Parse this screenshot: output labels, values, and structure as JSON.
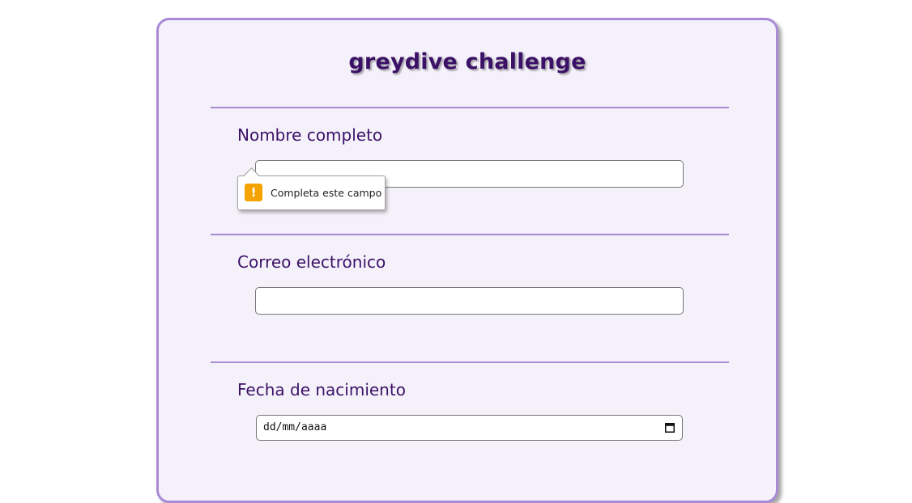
{
  "form": {
    "title": "greydive challenge",
    "fields": [
      {
        "label": "Nombre completo",
        "value": "",
        "type": "text"
      },
      {
        "label": "Correo electrónico",
        "value": "",
        "type": "email"
      },
      {
        "label": "Fecha de nacimiento",
        "placeholder": "dd/mm/aaaa",
        "type": "date"
      }
    ]
  },
  "validation_tooltip": {
    "message": "Completa este campo",
    "icon": "warning-icon"
  },
  "colors": {
    "accent": "#a98ad7",
    "card_background": "#f5f1fa",
    "text": "#3b1167",
    "warning": "#f5a300"
  }
}
